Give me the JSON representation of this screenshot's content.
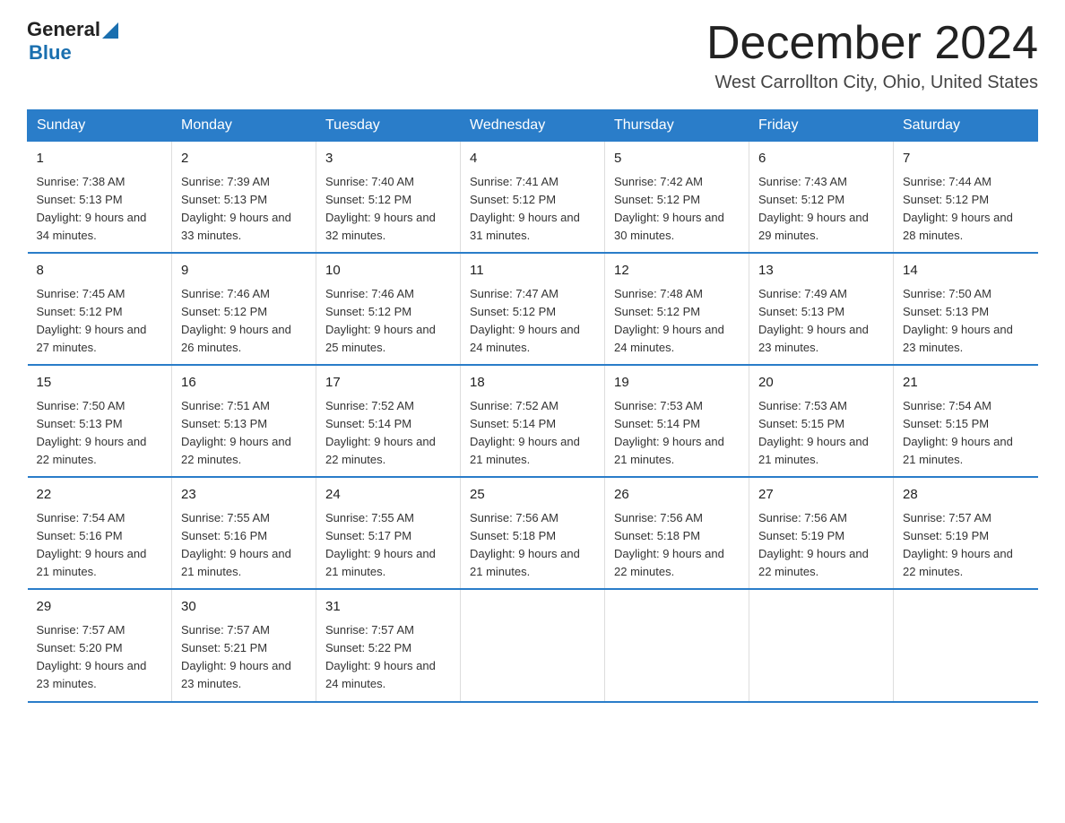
{
  "header": {
    "logo_general": "General",
    "logo_blue": "Blue",
    "month_title": "December 2024",
    "location": "West Carrollton City, Ohio, United States"
  },
  "days_of_week": [
    "Sunday",
    "Monday",
    "Tuesday",
    "Wednesday",
    "Thursday",
    "Friday",
    "Saturday"
  ],
  "weeks": [
    [
      {
        "day": "1",
        "sunrise": "7:38 AM",
        "sunset": "5:13 PM",
        "daylight": "9 hours and 34 minutes."
      },
      {
        "day": "2",
        "sunrise": "7:39 AM",
        "sunset": "5:13 PM",
        "daylight": "9 hours and 33 minutes."
      },
      {
        "day": "3",
        "sunrise": "7:40 AM",
        "sunset": "5:12 PM",
        "daylight": "9 hours and 32 minutes."
      },
      {
        "day": "4",
        "sunrise": "7:41 AM",
        "sunset": "5:12 PM",
        "daylight": "9 hours and 31 minutes."
      },
      {
        "day": "5",
        "sunrise": "7:42 AM",
        "sunset": "5:12 PM",
        "daylight": "9 hours and 30 minutes."
      },
      {
        "day": "6",
        "sunrise": "7:43 AM",
        "sunset": "5:12 PM",
        "daylight": "9 hours and 29 minutes."
      },
      {
        "day": "7",
        "sunrise": "7:44 AM",
        "sunset": "5:12 PM",
        "daylight": "9 hours and 28 minutes."
      }
    ],
    [
      {
        "day": "8",
        "sunrise": "7:45 AM",
        "sunset": "5:12 PM",
        "daylight": "9 hours and 27 minutes."
      },
      {
        "day": "9",
        "sunrise": "7:46 AM",
        "sunset": "5:12 PM",
        "daylight": "9 hours and 26 minutes."
      },
      {
        "day": "10",
        "sunrise": "7:46 AM",
        "sunset": "5:12 PM",
        "daylight": "9 hours and 25 minutes."
      },
      {
        "day": "11",
        "sunrise": "7:47 AM",
        "sunset": "5:12 PM",
        "daylight": "9 hours and 24 minutes."
      },
      {
        "day": "12",
        "sunrise": "7:48 AM",
        "sunset": "5:12 PM",
        "daylight": "9 hours and 24 minutes."
      },
      {
        "day": "13",
        "sunrise": "7:49 AM",
        "sunset": "5:13 PM",
        "daylight": "9 hours and 23 minutes."
      },
      {
        "day": "14",
        "sunrise": "7:50 AM",
        "sunset": "5:13 PM",
        "daylight": "9 hours and 23 minutes."
      }
    ],
    [
      {
        "day": "15",
        "sunrise": "7:50 AM",
        "sunset": "5:13 PM",
        "daylight": "9 hours and 22 minutes."
      },
      {
        "day": "16",
        "sunrise": "7:51 AM",
        "sunset": "5:13 PM",
        "daylight": "9 hours and 22 minutes."
      },
      {
        "day": "17",
        "sunrise": "7:52 AM",
        "sunset": "5:14 PM",
        "daylight": "9 hours and 22 minutes."
      },
      {
        "day": "18",
        "sunrise": "7:52 AM",
        "sunset": "5:14 PM",
        "daylight": "9 hours and 21 minutes."
      },
      {
        "day": "19",
        "sunrise": "7:53 AM",
        "sunset": "5:14 PM",
        "daylight": "9 hours and 21 minutes."
      },
      {
        "day": "20",
        "sunrise": "7:53 AM",
        "sunset": "5:15 PM",
        "daylight": "9 hours and 21 minutes."
      },
      {
        "day": "21",
        "sunrise": "7:54 AM",
        "sunset": "5:15 PM",
        "daylight": "9 hours and 21 minutes."
      }
    ],
    [
      {
        "day": "22",
        "sunrise": "7:54 AM",
        "sunset": "5:16 PM",
        "daylight": "9 hours and 21 minutes."
      },
      {
        "day": "23",
        "sunrise": "7:55 AM",
        "sunset": "5:16 PM",
        "daylight": "9 hours and 21 minutes."
      },
      {
        "day": "24",
        "sunrise": "7:55 AM",
        "sunset": "5:17 PM",
        "daylight": "9 hours and 21 minutes."
      },
      {
        "day": "25",
        "sunrise": "7:56 AM",
        "sunset": "5:18 PM",
        "daylight": "9 hours and 21 minutes."
      },
      {
        "day": "26",
        "sunrise": "7:56 AM",
        "sunset": "5:18 PM",
        "daylight": "9 hours and 22 minutes."
      },
      {
        "day": "27",
        "sunrise": "7:56 AM",
        "sunset": "5:19 PM",
        "daylight": "9 hours and 22 minutes."
      },
      {
        "day": "28",
        "sunrise": "7:57 AM",
        "sunset": "5:19 PM",
        "daylight": "9 hours and 22 minutes."
      }
    ],
    [
      {
        "day": "29",
        "sunrise": "7:57 AM",
        "sunset": "5:20 PM",
        "daylight": "9 hours and 23 minutes."
      },
      {
        "day": "30",
        "sunrise": "7:57 AM",
        "sunset": "5:21 PM",
        "daylight": "9 hours and 23 minutes."
      },
      {
        "day": "31",
        "sunrise": "7:57 AM",
        "sunset": "5:22 PM",
        "daylight": "9 hours and 24 minutes."
      },
      {
        "day": "",
        "sunrise": "",
        "sunset": "",
        "daylight": ""
      },
      {
        "day": "",
        "sunrise": "",
        "sunset": "",
        "daylight": ""
      },
      {
        "day": "",
        "sunrise": "",
        "sunset": "",
        "daylight": ""
      },
      {
        "day": "",
        "sunrise": "",
        "sunset": "",
        "daylight": ""
      }
    ]
  ]
}
